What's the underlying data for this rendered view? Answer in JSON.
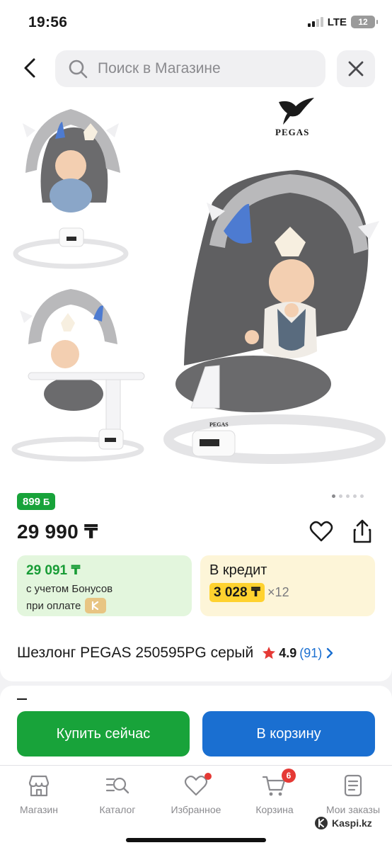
{
  "status_bar": {
    "time": "19:56",
    "network": "LTE",
    "battery": "12"
  },
  "header": {
    "search_placeholder": "Поиск в Магазине",
    "back_icon": "chevron-left-icon",
    "close_icon": "close-icon"
  },
  "gallery": {
    "brand_logo": "PEGAS",
    "chair_label": "PEGAS",
    "image_count": 5,
    "active_image": 1
  },
  "product": {
    "bonus_points": "899",
    "bonus_unit": "Б",
    "price": "29 990 ₸",
    "bonus_price": "29 091 ₸",
    "bonus_line1": "с учетом Бонусов",
    "bonus_line2": "при оплате",
    "credit_label": "В кредит",
    "credit_monthly": "3 028 ₸",
    "credit_term": "×12",
    "title": "Шезлонг PEGAS 250595PG серый",
    "rating": "4.9",
    "reviews": "(91)"
  },
  "actions": {
    "buy_now": "Купить сейчас",
    "add_to_cart": "В корзину"
  },
  "bottom_nav": {
    "items": [
      {
        "label": "Магазин",
        "icon": "shop-icon"
      },
      {
        "label": "Каталог",
        "icon": "catalog-search-icon"
      },
      {
        "label": "Избранное",
        "icon": "heart-icon"
      },
      {
        "label": "Корзина",
        "icon": "cart-icon"
      },
      {
        "label": "Мои заказы",
        "icon": "orders-icon"
      }
    ],
    "cart_badge": "6"
  },
  "watermark": "Kaspi.kz",
  "colors": {
    "green": "#18a33a",
    "blue": "#1a6fd1",
    "yellow": "#ffd22f",
    "red": "#e53935"
  }
}
